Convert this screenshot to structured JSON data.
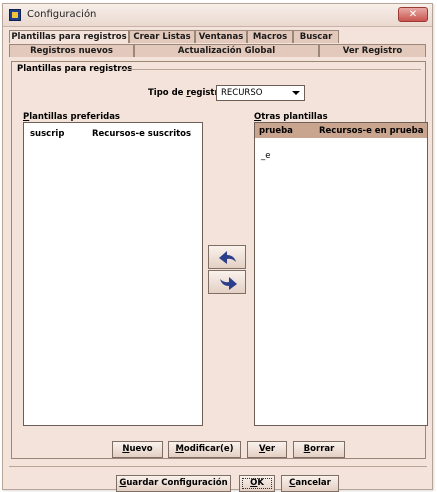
{
  "window": {
    "title": "Configuración",
    "close_glyph": "✕"
  },
  "tabs_row1": [
    {
      "label": "Plantillas para registros",
      "active": true
    },
    {
      "label": "Crear Listas"
    },
    {
      "label": "Ventanas"
    },
    {
      "label": "Macros"
    },
    {
      "label": "Buscar"
    }
  ],
  "tabs_row2": [
    {
      "label": "Registros nuevos"
    },
    {
      "label": "Actualización Global"
    },
    {
      "label": "Ver Registro"
    }
  ],
  "panel": {
    "group_title": "Plantillas para registros",
    "record_type": {
      "label_pre": "Tipo de ",
      "label_u": "r",
      "label_post": "egistro",
      "value": "RECURSO"
    },
    "preferred": {
      "title_pre": "",
      "title_u": "P",
      "title_post": "lantillas preferidas",
      "rows": [
        {
          "name": "suscrip",
          "description": "Recursos-e suscritos"
        }
      ]
    },
    "others": {
      "title_pre": "",
      "title_u": "O",
      "title_post": "tras plantillas",
      "rows": [
        {
          "name": "prueba",
          "description": "Recursos-e en prueba",
          "selected": true
        },
        {
          "name": "_e",
          "description": ""
        }
      ]
    },
    "arrows": {
      "left_icon": "arrow-left-icon",
      "right_icon": "arrow-right-icon"
    },
    "buttons": [
      {
        "u": "N",
        "rest": "uevo"
      },
      {
        "u": "M",
        "rest": "odificar(e)"
      },
      {
        "u": "V",
        "rest": "er"
      },
      {
        "u": "B",
        "rest": "orrar"
      }
    ]
  },
  "footer": {
    "save": {
      "u": "G",
      "rest": "uardar Configuración"
    },
    "ok": {
      "u": "O",
      "rest": "K"
    },
    "cancel": {
      "u": "C",
      "rest": "ancelar"
    }
  },
  "colors": {
    "header": "#c9a48e",
    "background": "#f4e3da",
    "arrow": "#2b3f8c"
  }
}
